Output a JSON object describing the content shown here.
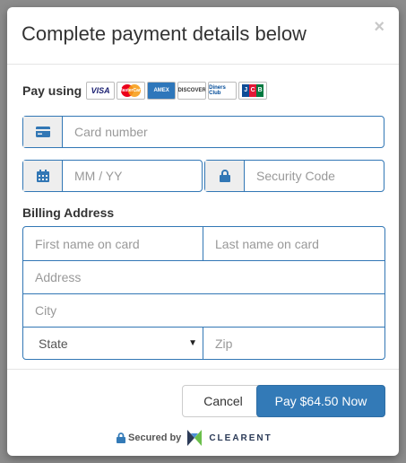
{
  "header": {
    "title": "Complete payment details below",
    "close_label": "×"
  },
  "pay_using": {
    "label": "Pay using",
    "cards": [
      {
        "name": "visa",
        "text": "VISA"
      },
      {
        "name": "mastercard",
        "text": "MasterCard"
      },
      {
        "name": "amex",
        "text": "AMEX"
      },
      {
        "name": "discover",
        "text": "DISCOVER"
      },
      {
        "name": "diners",
        "text": "Diners Club"
      },
      {
        "name": "jcb",
        "text": "JCB"
      }
    ]
  },
  "fields": {
    "card_number": {
      "placeholder": "Card number",
      "icon": "credit-card-icon"
    },
    "expiry": {
      "placeholder": "MM / YY",
      "icon": "calendar-icon"
    },
    "security": {
      "placeholder": "Security Code",
      "icon": "lock-icon"
    }
  },
  "billing": {
    "label": "Billing Address",
    "first_name": "First name on card",
    "last_name": "Last name on card",
    "address": "Address",
    "city": "City",
    "state": "State",
    "zip": "Zip"
  },
  "footer": {
    "cancel_label": "Cancel",
    "pay_label": "Pay $64.50 Now",
    "secured_label": "Secured by",
    "brand": "CLEARENT"
  },
  "colors": {
    "accent": "#337ab7",
    "border": "#3277b5"
  }
}
